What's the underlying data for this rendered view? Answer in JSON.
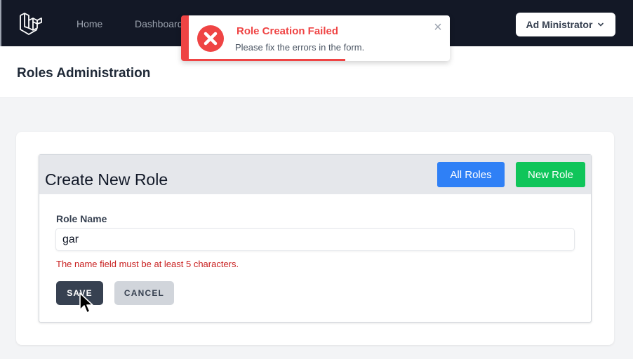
{
  "nav": {
    "links": [
      "Home",
      "Dashboard"
    ],
    "user_name": "Ad Ministrator",
    "logo_icon": "laravel-logo-icon",
    "dropdown_icon": "chevron-down-icon"
  },
  "header": {
    "title": "Roles Administration"
  },
  "panel": {
    "title": "Create New Role",
    "all_roles_label": "All Roles",
    "new_role_label": "New Role"
  },
  "form": {
    "label": "Role Name",
    "value": "gar",
    "error": "The name field must be at least 5 characters.",
    "save_label": "SAVE",
    "cancel_label": "CANCEL"
  },
  "toast": {
    "title": "Role Creation Failed",
    "message": "Please fix the errors in the form.",
    "close": "×",
    "icon": "error-x-circle-icon",
    "progress": 0.6
  },
  "colors": {
    "nav_bg": "#131826",
    "accent_blue": "#2f80f6",
    "accent_green": "#0fc55a",
    "error_red": "#ef4444",
    "save_bg": "#374151"
  }
}
